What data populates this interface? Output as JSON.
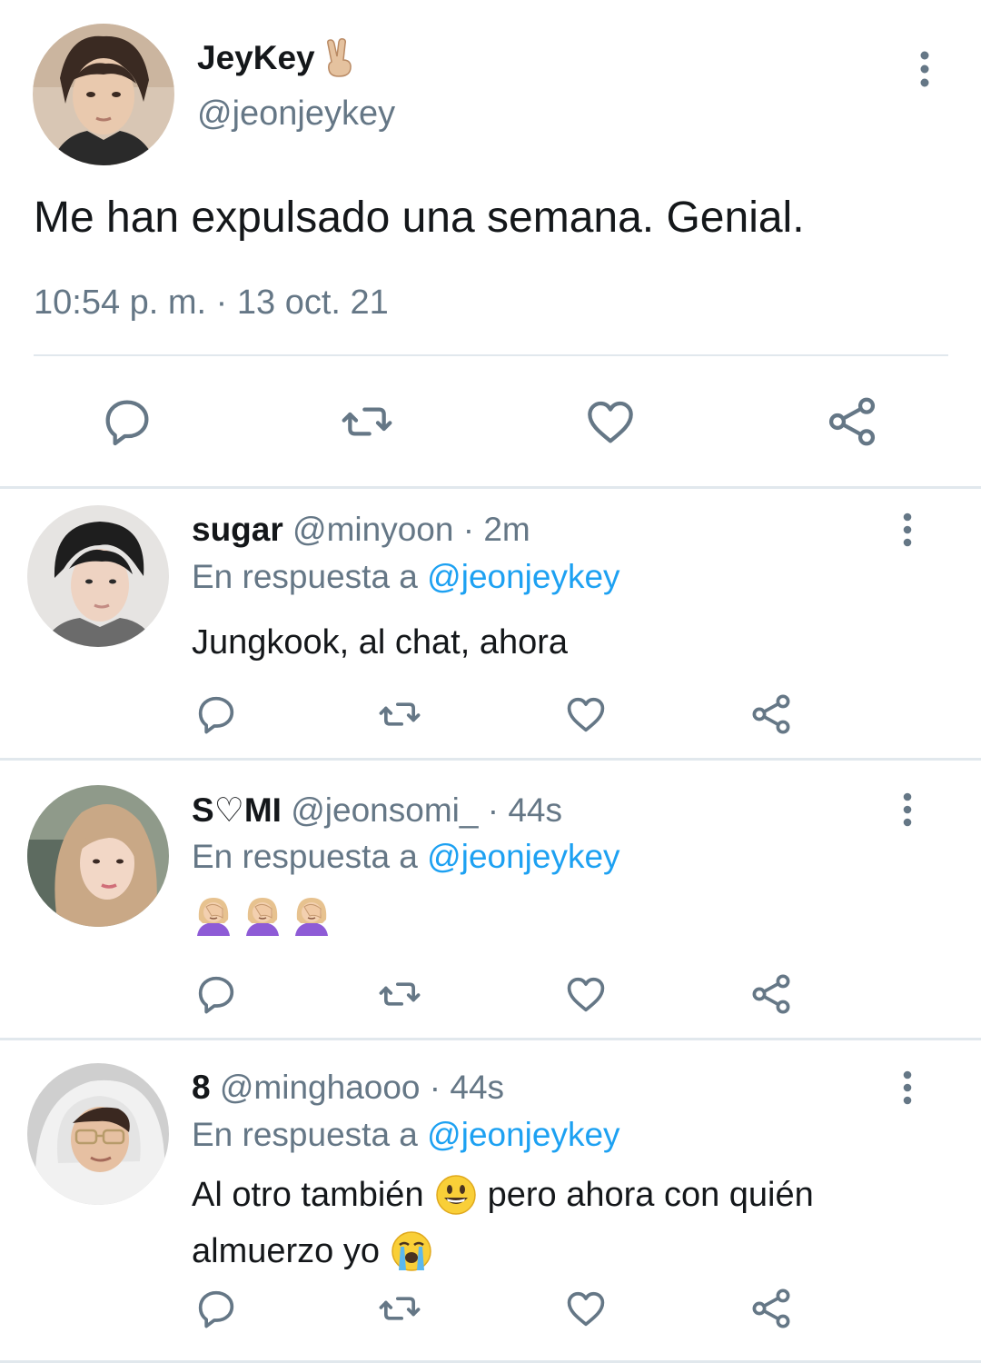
{
  "main_tweet": {
    "name": "JeyKey",
    "handle": "@jeonjeykey",
    "text": "Me han expulsado una semana. Genial.",
    "timestamp": "10:54 p. m. · 13 oct. 21",
    "name_emoji": "victory-hand-emoji"
  },
  "replies": [
    {
      "name": "sugar",
      "handle": "@minyoon",
      "separator": "·",
      "time": "2m",
      "replying_prefix": "En respuesta a",
      "replying_to": "@jeonjeykey",
      "text": "Jungkook, al chat, ahora"
    },
    {
      "name": "S♡MI",
      "handle": "@jeonsomi_",
      "separator": "·",
      "time": "44s",
      "replying_prefix": "En respuesta a",
      "replying_to": "@jeonjeykey",
      "text": "",
      "emojis": [
        "facepalm-emoji",
        "facepalm-emoji",
        "facepalm-emoji"
      ]
    },
    {
      "name": "8",
      "handle": "@minghaooo",
      "separator": "·",
      "time": "44s",
      "replying_prefix": "En respuesta a",
      "replying_to": "@jeonjeykey",
      "text_part1": "Al otro también",
      "text_part2": "pero ahora con quién",
      "text_part3": "almuerzo yo",
      "emojis": [
        "grinning-face-emoji",
        "loudly-crying-face-emoji"
      ]
    }
  ],
  "colors": {
    "text": "#14171a",
    "muted": "#657786",
    "accent": "#1da1f2",
    "divider": "#e1e8ed"
  },
  "icons": [
    "reply-icon",
    "retweet-icon",
    "like-icon",
    "share-icon",
    "more-icon"
  ]
}
